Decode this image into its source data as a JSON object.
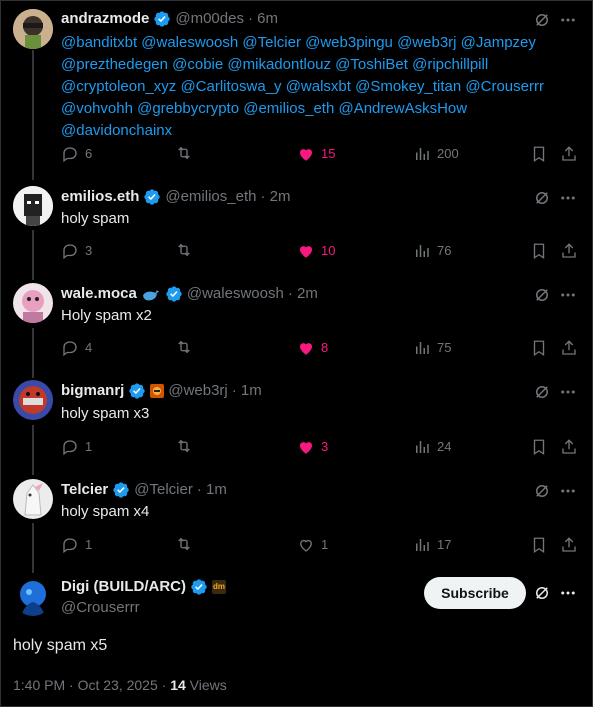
{
  "posts": [
    {
      "name": "andrazmode",
      "handle": "@m00des",
      "time": "· 6m",
      "mentions_lines": [
        "@banditxbt @waleswoosh @Telcier @web3pingu @web3rj @Jampzey",
        "@prezthedegen @cobie @mikadontlouz @ToshiBet @ripchillpill",
        "@cryptoleon_xyz @Carlitoswa_y @walsxbt @Smokey_titan @Crouserrr",
        "@vohvohh @grebbycrypto @emilios_eth @AndrewAsksHow",
        "@davidonchainx"
      ],
      "replies": "6",
      "reposts": "",
      "likes": "15",
      "views": "200",
      "liked": true
    },
    {
      "name": "emilios.eth",
      "handle": "@emilios_eth",
      "time": "· 2m",
      "text": "holy spam",
      "replies": "3",
      "likes": "10",
      "views": "76",
      "liked": true
    },
    {
      "name": "wale.moca",
      "handle": "@waleswoosh",
      "time": "· 2m",
      "text": "Holy spam x2",
      "replies": "4",
      "likes": "8",
      "views": "75",
      "liked": true
    },
    {
      "name": "bigmanrj",
      "handle": "@web3rj",
      "time": "· 1m",
      "text": "holy spam x3",
      "replies": "1",
      "likes": "3",
      "views": "24",
      "liked": true
    },
    {
      "name": "Telcier",
      "handle": "@Telcier",
      "time": "· 1m",
      "text": "holy spam x4",
      "replies": "1",
      "likes": "1",
      "views": "17",
      "liked": false
    }
  ],
  "main": {
    "name": "Digi (BUILD/ARC)",
    "handle": "@Crouserrr",
    "badge": "dm",
    "text": "holy spam x5",
    "timestamp": "1:40 PM · Oct 23, 2025 · ",
    "views_count": "14",
    "views_label": " Views",
    "subscribe_label": "Subscribe"
  },
  "colors": {
    "accent": "#1d9bf0",
    "like": "#f91880",
    "muted": "#71767b",
    "text": "#e7e9ea"
  }
}
